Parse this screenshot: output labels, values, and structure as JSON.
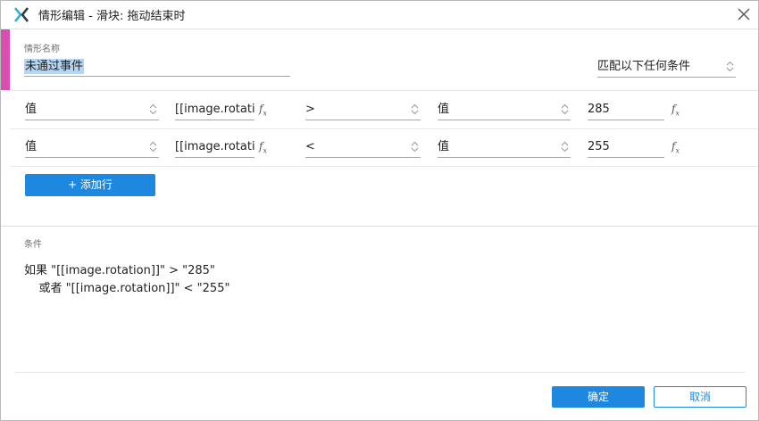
{
  "window": {
    "title": "情形编辑   -   滑块: 拖动结束时",
    "accent_color": "#d84fb0",
    "primary_color": "#1e88e0",
    "logo_icon": "axure-x-logo",
    "close_icon": "close-x"
  },
  "case": {
    "name_label": "情形名称",
    "name_value": "未通过事件",
    "match_mode": "匹配以下任何条件"
  },
  "rows": [
    {
      "left_type": "值",
      "left_value": "[[image.rotation]]",
      "operator": ">",
      "right_type": "值",
      "right_value": "285"
    },
    {
      "left_type": "值",
      "left_value": "[[image.rotation]]",
      "operator": "<",
      "right_type": "值",
      "right_value": "255"
    }
  ],
  "fx_symbol": "f",
  "fx_sub": "x",
  "add_row_label": "+ 添加行",
  "conditions": {
    "label": "条件",
    "line1": "如果 \"[[image.rotation]]\" > \"285\"",
    "line2": "    或者 \"[[image.rotation]]\" < \"255\""
  },
  "footer": {
    "ok_label": "确定",
    "cancel_label": "取消"
  }
}
